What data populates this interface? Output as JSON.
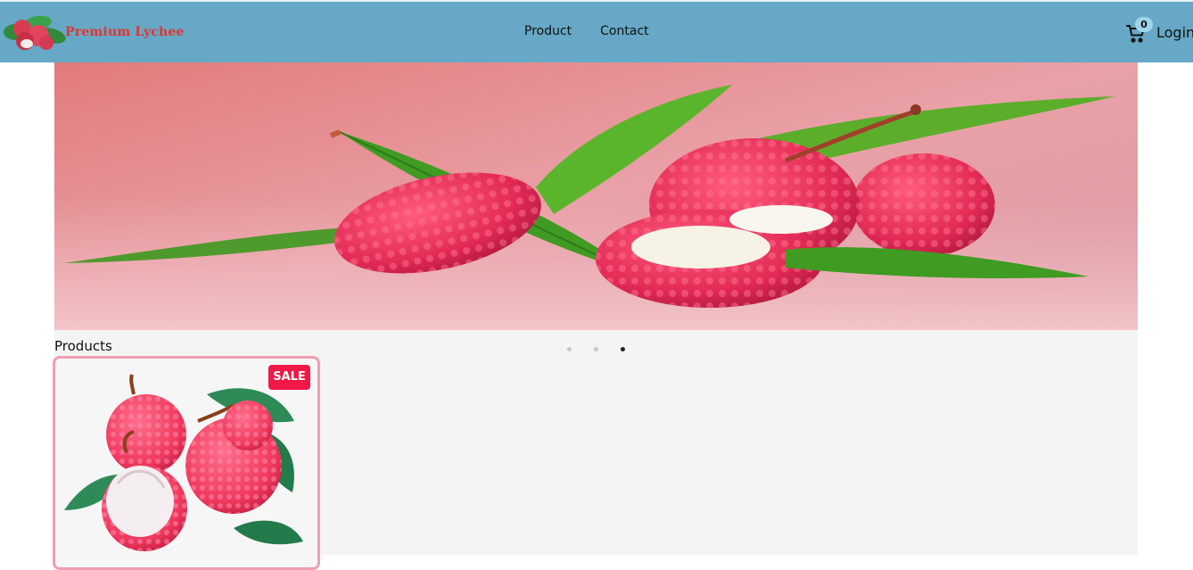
{
  "header": {
    "brand": "Premium Lychee",
    "nav": [
      {
        "label": "Product"
      },
      {
        "label": "Contact"
      }
    ],
    "cart_count": "0",
    "login_label": "Login"
  },
  "hero": {
    "slide_count": 3,
    "active_slide": 3
  },
  "products": {
    "title": "Products",
    "items": [
      {
        "badge": "SALE"
      }
    ]
  },
  "colors": {
    "navbar": "#66a8c5",
    "brand_text": "#e3342f",
    "sale_badge": "#ef1846",
    "card_border": "#ee9fb3"
  }
}
